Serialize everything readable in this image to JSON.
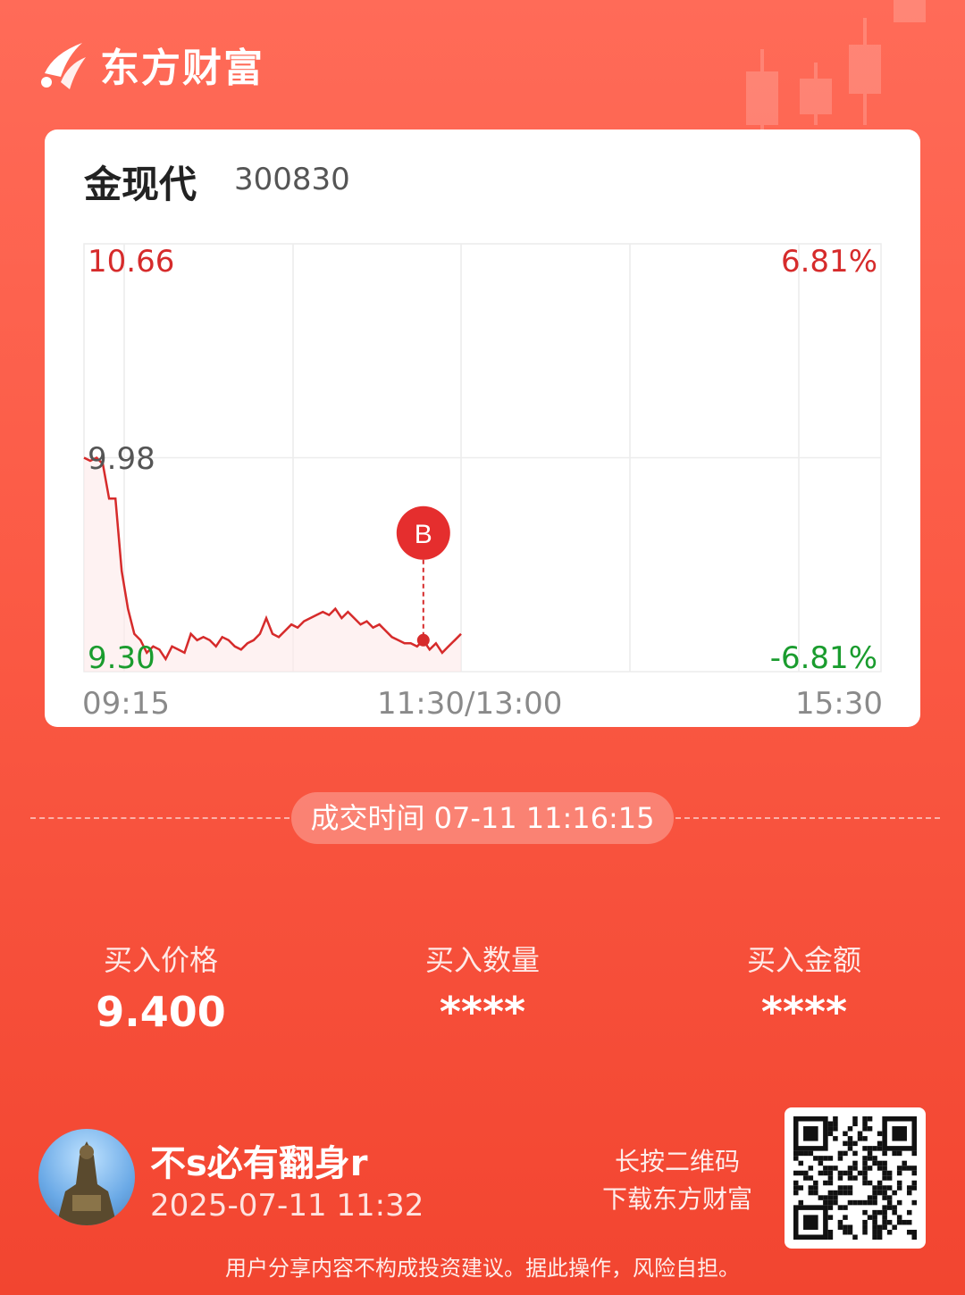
{
  "app": {
    "brand_name": "东方财富"
  },
  "stock": {
    "name": "金现代",
    "code": "300830"
  },
  "chart_data": {
    "type": "line",
    "y_high_label": "10.66",
    "y_mid_label": "9.98",
    "y_low_label": "9.30",
    "pct_high_label": "6.81%",
    "pct_low_label": "-6.81%",
    "ylim": [
      9.3,
      10.66
    ],
    "x_tick_labels": [
      "09:15",
      "11:30/13:00",
      "15:30"
    ],
    "trade_marker": {
      "label": "B",
      "time": "11:16",
      "price": 9.4
    },
    "series": [
      {
        "values": [
          9.98,
          9.97,
          9.98,
          9.96,
          9.85,
          9.85,
          9.62,
          9.5,
          9.42,
          9.4,
          9.36,
          9.38,
          9.37,
          9.34,
          9.38,
          9.37,
          9.36,
          9.42,
          9.4,
          9.41,
          9.4,
          9.38,
          9.41,
          9.4,
          9.38,
          9.37,
          9.39,
          9.4,
          9.42,
          9.47,
          9.42,
          9.41,
          9.43,
          9.45,
          9.44,
          9.46,
          9.47,
          9.48,
          9.49,
          9.48,
          9.5,
          9.47,
          9.49,
          9.47,
          9.45,
          9.46,
          9.44,
          9.45,
          9.43,
          9.41,
          9.4,
          9.39,
          9.39,
          9.38,
          9.4,
          9.37,
          9.39,
          9.36,
          9.38,
          9.4,
          9.42
        ]
      }
    ]
  },
  "trade": {
    "time_label": "成交时间 07-11 11:16:15"
  },
  "stats": {
    "price_label": "买入价格",
    "price_value": "9.400",
    "qty_label": "买入数量",
    "qty_value": "****",
    "amount_label": "买入金额",
    "amount_value": "****"
  },
  "user": {
    "name": "不s必有翻身r",
    "time": "2025-07-11 11:32"
  },
  "download": {
    "line1": "长按二维码",
    "line2": "下载东方财富"
  },
  "disclaimer": "用户分享内容不构成投资建议。据此操作，风险自担。"
}
